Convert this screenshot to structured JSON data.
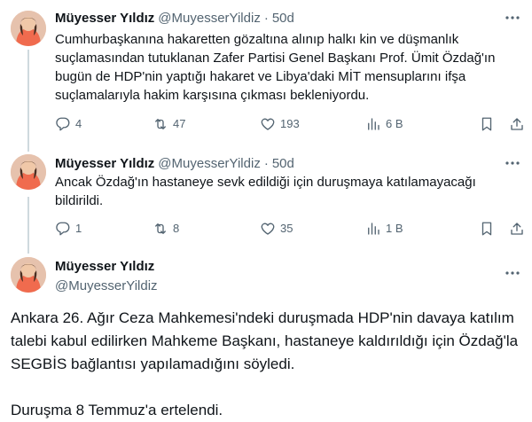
{
  "author": {
    "name": "Müyesser Yıldız",
    "handle": "@MuyesserYildiz",
    "separator": "·"
  },
  "tweets": [
    {
      "time": "50d",
      "text": "Cumhurbaşkanına hakaretten gözaltına alınıp halkı kin ve düşmanlık suçlamasından tutuklanan Zafer Partisi Genel Başkanı Prof. Ümit Özdağ'ın bugün de HDP'nin yaptığı hakaret ve Libya'daki MİT mensuplarını ifşa suçlamalarıyla hakim karşısına çıkması bekleniyordu.",
      "replies": "4",
      "retweets": "47",
      "likes": "193",
      "views": "6 B"
    },
    {
      "time": "50d",
      "text": "Ancak Özdağ'ın hastaneye sevk edildiği için duruşmaya katılamayacağı bildirildi.",
      "replies": "1",
      "retweets": "8",
      "likes": "35",
      "views": "1 B"
    },
    {
      "text": "Ankara 26. Ağır Ceza Mahkemesi'ndeki duruşmada HDP'nin davaya katılım talebi kabul edilirken Mahkeme Başkanı, hastaneye kaldırıldığı için Özdağ'la SEGBİS bağlantısı yapılamadığını söyledi.\n\nDuruşma 8 Temmuz'a ertelendi."
    }
  ],
  "icons": {
    "more": "more-dots-icon",
    "reply": "reply-icon",
    "retweet": "retweet-icon",
    "like": "heart-icon",
    "views": "views-chart-icon",
    "bookmark": "bookmark-icon",
    "share": "share-icon"
  },
  "colors": {
    "text": "#0f1419",
    "secondary": "#536471",
    "thread_line": "#cfd9de",
    "avatar_bg": "#e9b9a3"
  }
}
